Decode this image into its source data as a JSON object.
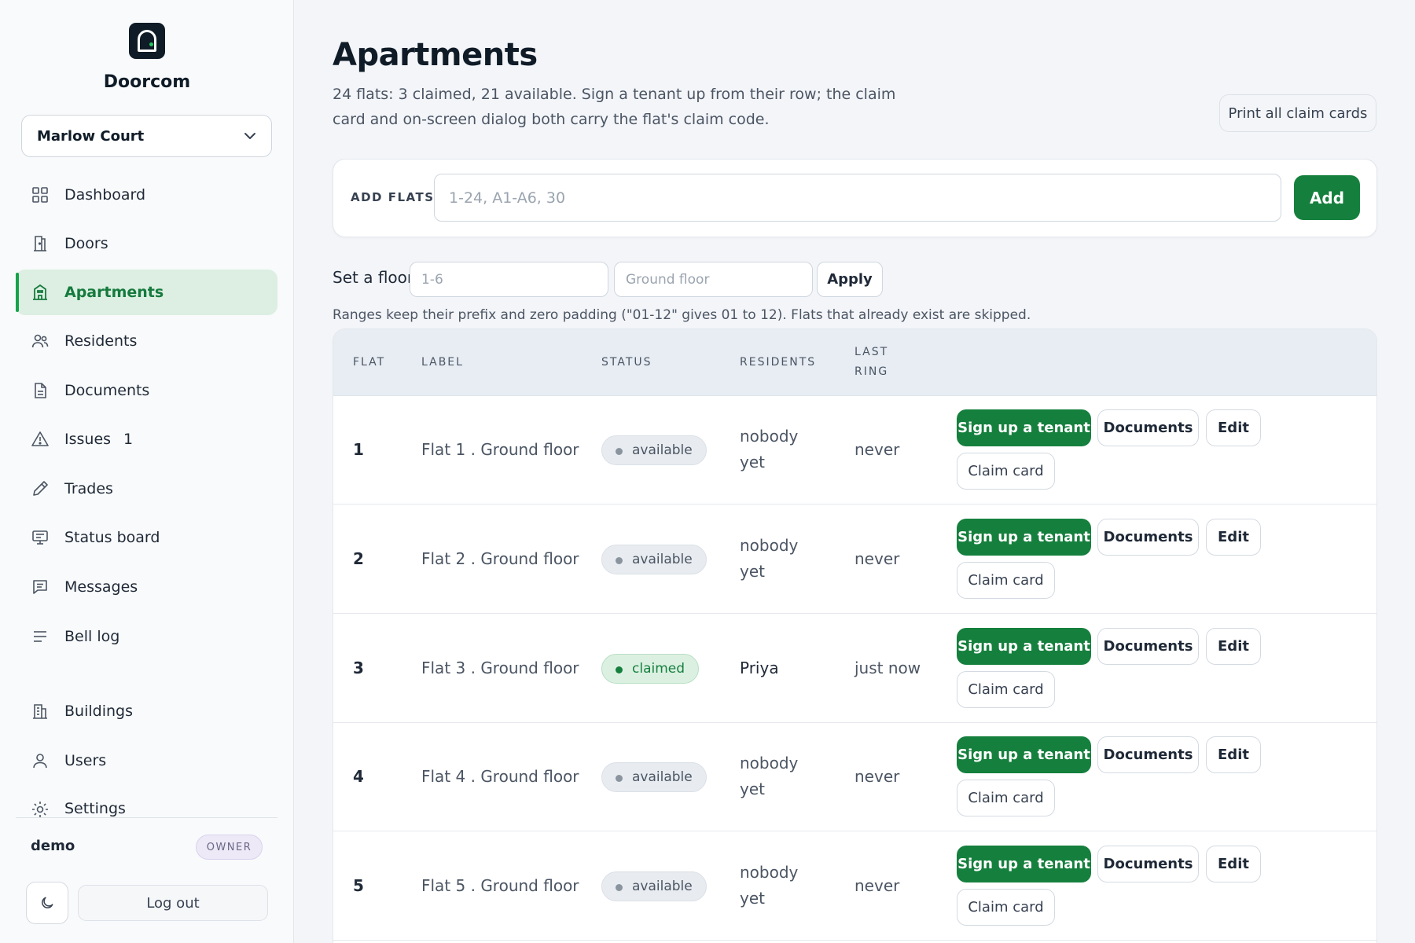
{
  "app": {
    "brand": "Doorcom"
  },
  "sidebar": {
    "building": "Marlow Court",
    "items": [
      {
        "label": "Dashboard",
        "icon": "grid-icon"
      },
      {
        "label": "Doors",
        "icon": "door-icon"
      },
      {
        "label": "Apartments",
        "icon": "apartment-icon",
        "active": true
      },
      {
        "label": "Residents",
        "icon": "people-icon"
      },
      {
        "label": "Documents",
        "icon": "document-icon"
      },
      {
        "label": "Issues",
        "icon": "warning-icon",
        "count": "1"
      },
      {
        "label": "Trades",
        "icon": "wrench-icon"
      },
      {
        "label": "Status board",
        "icon": "monitor-icon"
      },
      {
        "label": "Messages",
        "icon": "message-icon"
      },
      {
        "label": "Bell log",
        "icon": "list-icon"
      },
      {
        "label": "Buildings",
        "icon": "building-icon"
      },
      {
        "label": "Users",
        "icon": "user-icon"
      },
      {
        "label": "Settings",
        "icon": "settings-icon"
      }
    ],
    "user": {
      "name": "demo",
      "role": "OWNER"
    },
    "logout_label": "Log out"
  },
  "main": {
    "title": "Apartments",
    "description": "24 flats: 3 claimed, 21 available. Sign a tenant up from their row; the claim card and on-screen dialog both carry the flat's claim code.",
    "print_label": "Print all claim cards",
    "add": {
      "label": "ADD FLATS",
      "placeholder": "1-24, A1-A6, 30",
      "button": "Add"
    },
    "floor": {
      "label": "Set a floor",
      "range_placeholder": "1-6",
      "name_placeholder": "Ground floor",
      "button": "Apply"
    },
    "hint": "Ranges keep their prefix and zero padding (\"01-12\" gives 01 to 12). Flats that already exist are skipped.",
    "table": {
      "columns": {
        "flat": "FLAT",
        "label": "LABEL",
        "status": "STATUS",
        "residents": "RESIDENTS",
        "last_ring_1": "LAST",
        "last_ring_2": "RING"
      },
      "actions": {
        "sign_up": "Sign up a tenant",
        "documents": "Documents",
        "edit": "Edit",
        "claim_card": "Claim card"
      },
      "rows": [
        {
          "flat": "1",
          "label": "Flat 1 . Ground floor",
          "status": "available",
          "residents_1": "nobody",
          "residents_2": "yet",
          "last_ring": "never"
        },
        {
          "flat": "2",
          "label": "Flat 2 . Ground floor",
          "status": "available",
          "residents_1": "nobody",
          "residents_2": "yet",
          "last_ring": "never"
        },
        {
          "flat": "3",
          "label": "Flat 3 . Ground floor",
          "status": "claimed",
          "residents_1": "Priya",
          "residents_2": "",
          "last_ring": "just now"
        },
        {
          "flat": "4",
          "label": "Flat 4 . Ground floor",
          "status": "available",
          "residents_1": "nobody",
          "residents_2": "yet",
          "last_ring": "never"
        },
        {
          "flat": "5",
          "label": "Flat 5 . Ground floor",
          "status": "available",
          "residents_1": "nobody",
          "residents_2": "yet",
          "last_ring": "never"
        }
      ]
    }
  },
  "colors": {
    "accent": "#15803d",
    "active_bg": "#dcefe2",
    "logo": "#0f1b27"
  }
}
